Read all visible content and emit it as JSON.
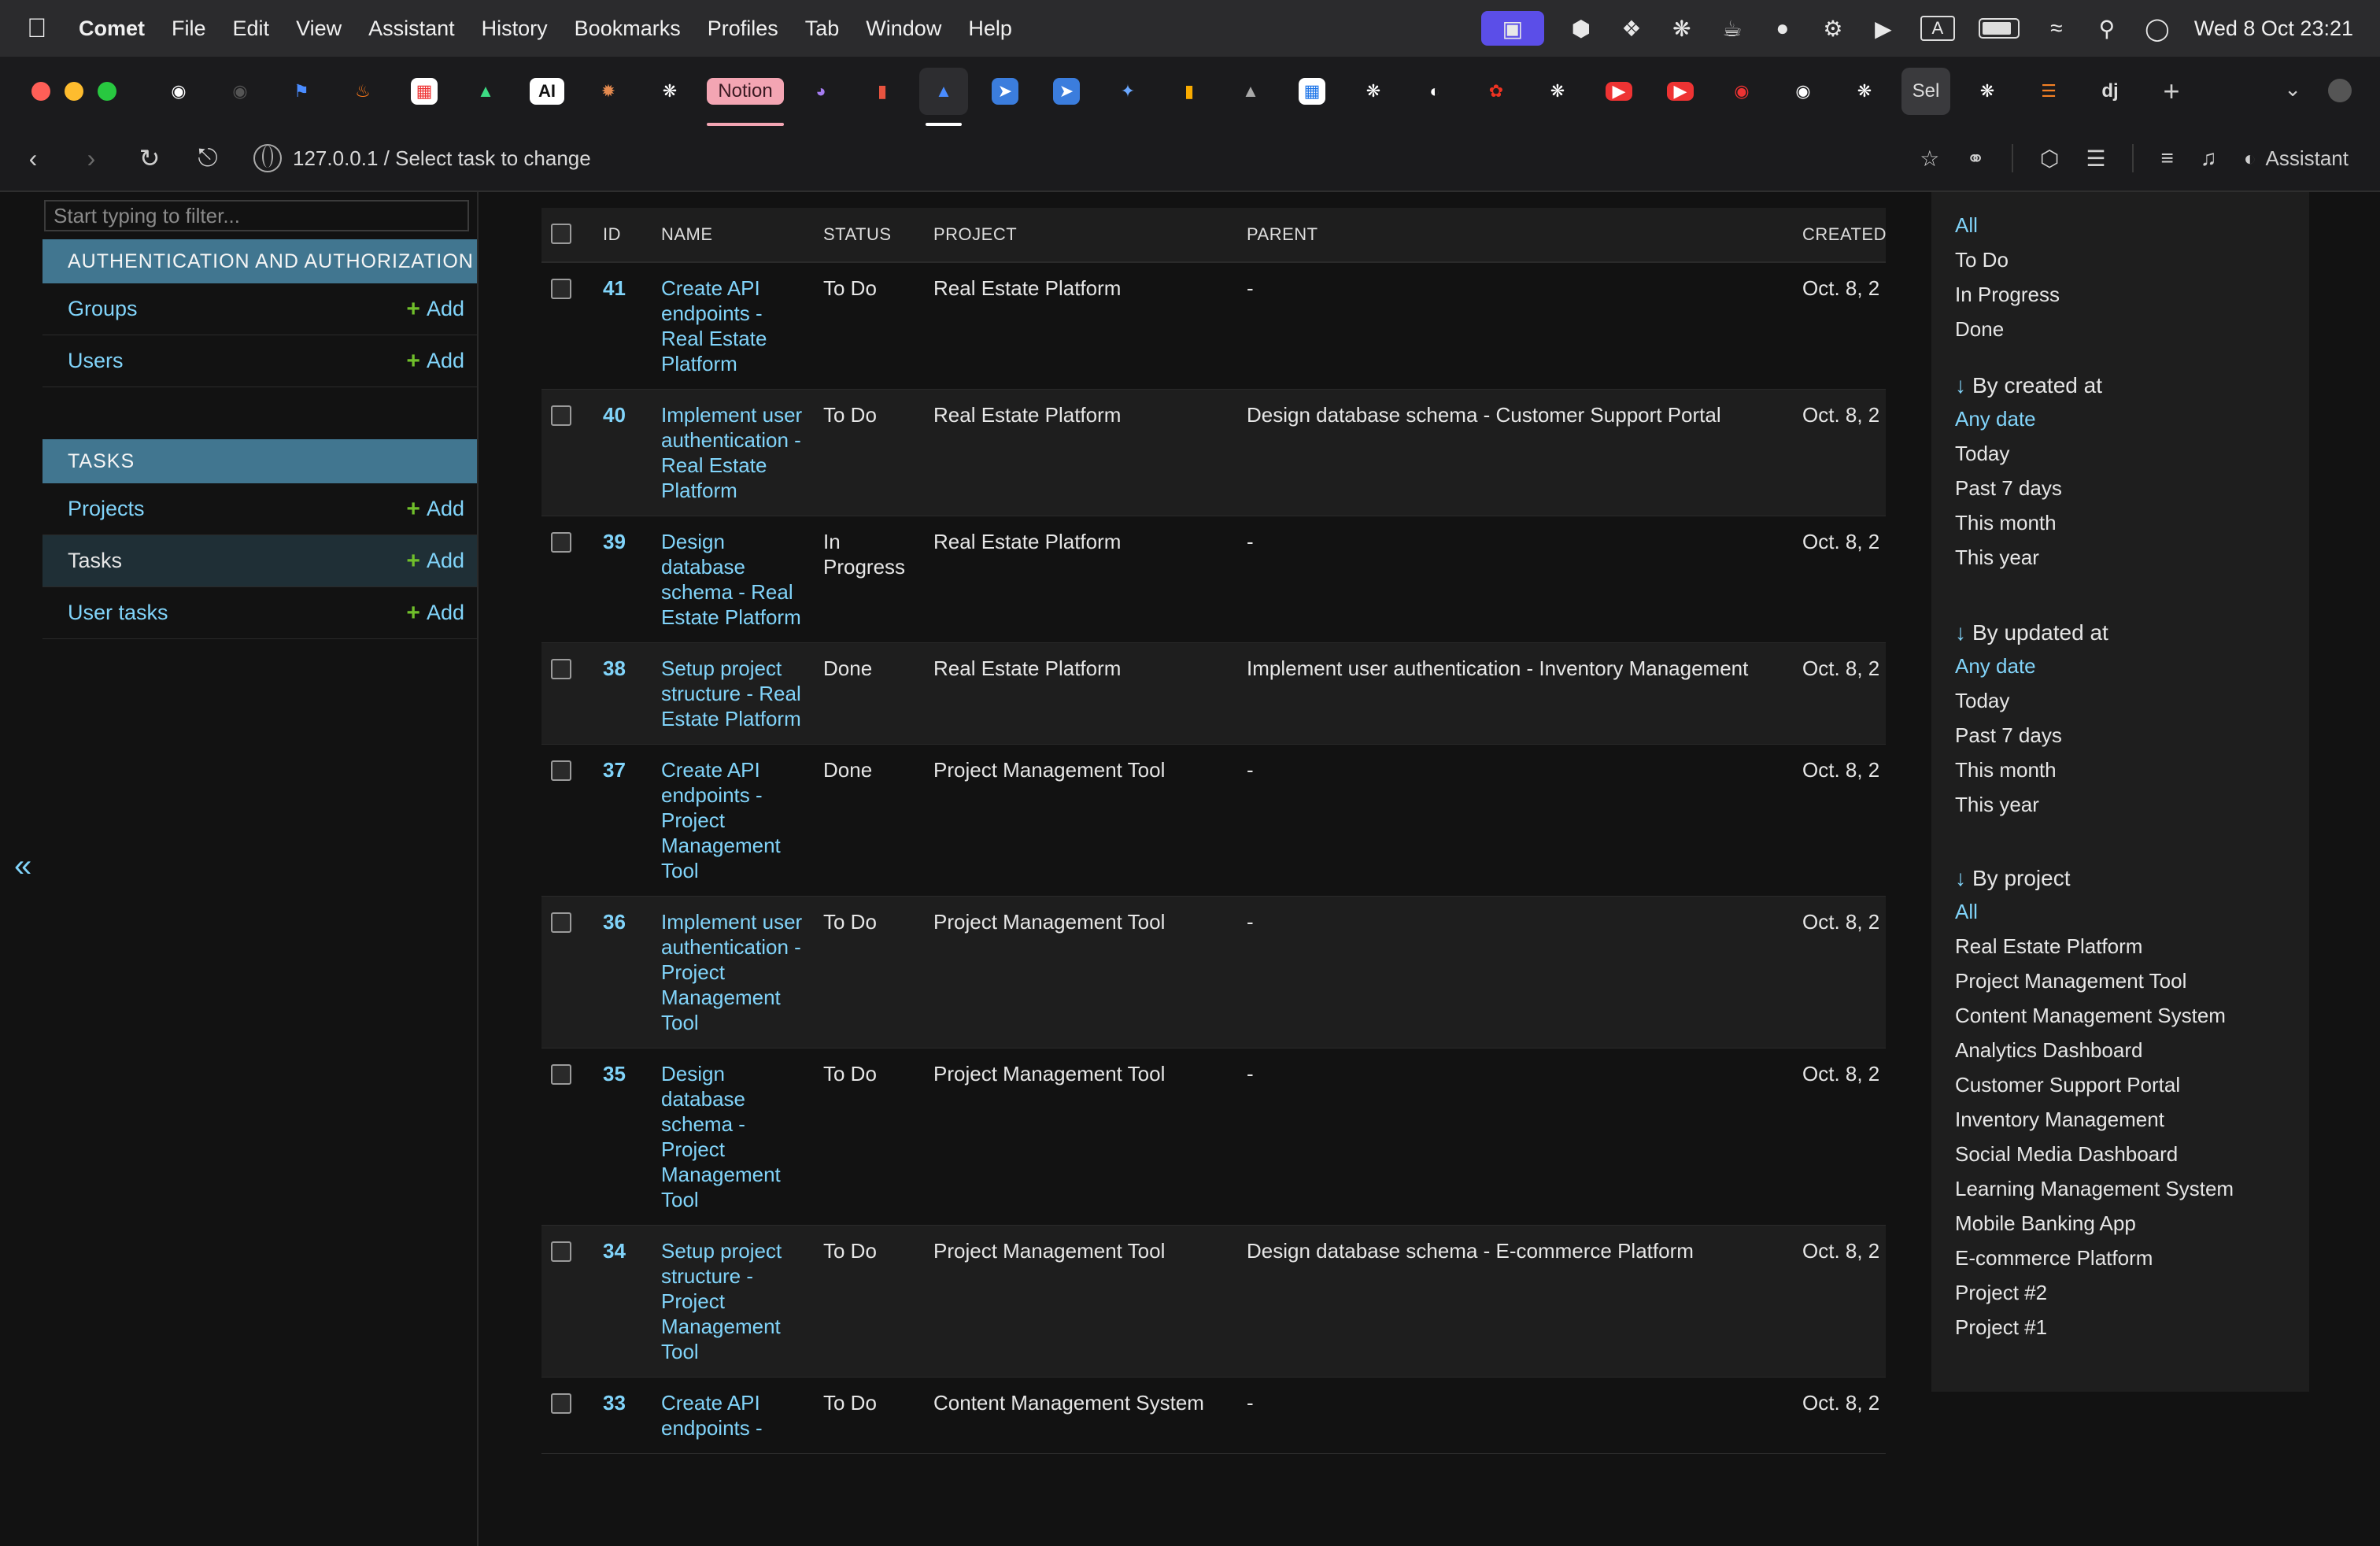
{
  "menubar": {
    "app_name": "Comet",
    "items": [
      "File",
      "Edit",
      "View",
      "Assistant",
      "History",
      "Bookmarks",
      "Profiles",
      "Tab",
      "Window",
      "Help"
    ],
    "clock": "Wed 8 Oct  23:21",
    "input_mode": "A"
  },
  "tabs": {
    "ai_label": "AI",
    "notion_label": "Notion",
    "sel_label": "Sel",
    "dj_label": "dj"
  },
  "toolbar": {
    "url": "127.0.0.1 / Select task to change",
    "assistant_label": "Assistant"
  },
  "sidebar": {
    "filter_placeholder": "Start typing to filter...",
    "modules": [
      {
        "title": "Authentication and Authorization",
        "rows": [
          {
            "label": "Groups",
            "add": "Add"
          },
          {
            "label": "Users",
            "add": "Add"
          }
        ]
      },
      {
        "title": "Tasks",
        "rows": [
          {
            "label": "Projects",
            "add": "Add"
          },
          {
            "label": "Tasks",
            "add": "Add"
          },
          {
            "label": "User tasks",
            "add": "Add"
          }
        ]
      }
    ],
    "collapse_glyph": "«"
  },
  "table": {
    "columns": [
      "ID",
      "NAME",
      "STATUS",
      "PROJECT",
      "PARENT",
      "CREATED"
    ],
    "rows": [
      {
        "id": "41",
        "name": "Create API endpoints - Real Estate Platform",
        "status": "To Do",
        "project": "Real Estate Platform",
        "parent": "-",
        "created": "Oct. 8, 2"
      },
      {
        "id": "40",
        "name": "Implement user authentication - Real Estate Platform",
        "status": "To Do",
        "project": "Real Estate Platform",
        "parent": "Design database schema - Customer Support Portal",
        "created": "Oct. 8, 2"
      },
      {
        "id": "39",
        "name": "Design database schema - Real Estate Platform",
        "status": "In Progress",
        "project": "Real Estate Platform",
        "parent": "-",
        "created": "Oct. 8, 2"
      },
      {
        "id": "38",
        "name": "Setup project structure - Real Estate Platform",
        "status": "Done",
        "project": "Real Estate Platform",
        "parent": "Implement user authentication - Inventory Management",
        "created": "Oct. 8, 2"
      },
      {
        "id": "37",
        "name": "Create API endpoints - Project Management Tool",
        "status": "Done",
        "project": "Project Management Tool",
        "parent": "-",
        "created": "Oct. 8, 2"
      },
      {
        "id": "36",
        "name": "Implement user authentication - Project Management Tool",
        "status": "To Do",
        "project": "Project Management Tool",
        "parent": "-",
        "created": "Oct. 8, 2"
      },
      {
        "id": "35",
        "name": "Design database schema - Project Management Tool",
        "status": "To Do",
        "project": "Project Management Tool",
        "parent": "-",
        "created": "Oct. 8, 2"
      },
      {
        "id": "34",
        "name": "Setup project structure - Project Management Tool",
        "status": "To Do",
        "project": "Project Management Tool",
        "parent": "Design database schema - E-commerce Platform",
        "created": "Oct. 8, 2"
      },
      {
        "id": "33",
        "name": "Create API endpoints -",
        "status": "To Do",
        "project": "Content Management System",
        "parent": "-",
        "created": "Oct. 8, 2"
      }
    ]
  },
  "filters": {
    "status": {
      "options": [
        "All",
        "To Do",
        "In Progress",
        "Done"
      ],
      "selected": "All"
    },
    "created_at": {
      "title": "By created at",
      "options": [
        "Any date",
        "Today",
        "Past 7 days",
        "This month",
        "This year"
      ],
      "selected": "Any date"
    },
    "updated_at": {
      "title": "By updated at",
      "options": [
        "Any date",
        "Today",
        "Past 7 days",
        "This month",
        "This year"
      ],
      "selected": "Any date"
    },
    "project": {
      "title": "By project",
      "options": [
        "All",
        "Real Estate Platform",
        "Project Management Tool",
        "Content Management System",
        "Analytics Dashboard",
        "Customer Support Portal",
        "Inventory Management",
        "Social Media Dashboard",
        "Learning Management System",
        "Mobile Banking App",
        "E-commerce Platform",
        "Project #2",
        "Project #1"
      ],
      "selected": "All"
    }
  },
  "colors": {
    "link": "#81d4fa",
    "module_header": "#417690",
    "add_plus": "#70bf2b",
    "row_alt": "#1e1e1e",
    "background": "#121212"
  }
}
